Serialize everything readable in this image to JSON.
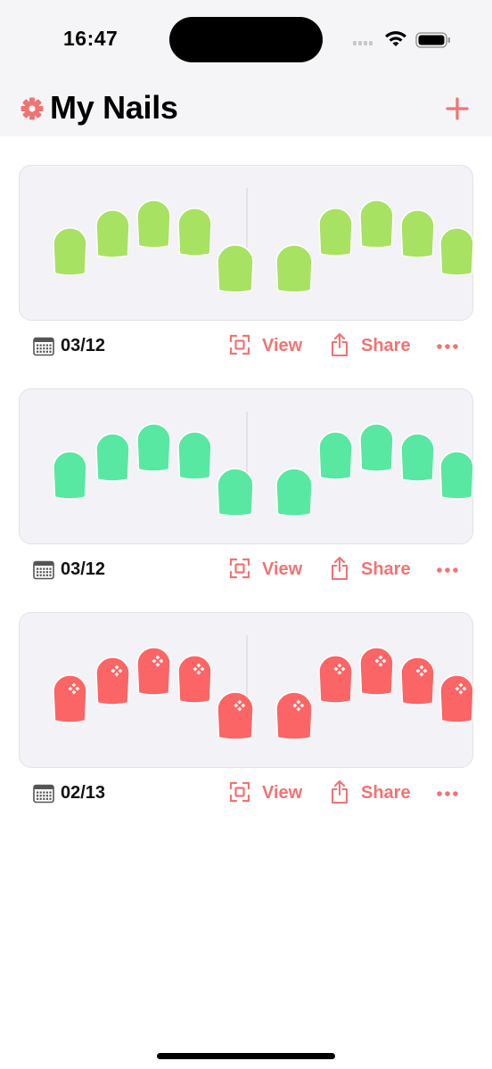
{
  "status_bar": {
    "time": "16:47"
  },
  "header": {
    "title": "My Nails"
  },
  "colors": {
    "accent": "#f07473"
  },
  "actions": {
    "view_label": "View",
    "share_label": "Share"
  },
  "designs": [
    {
      "date": "03/12",
      "nail_color": "#a8e262",
      "decorated": false
    },
    {
      "date": "03/12",
      "nail_color": "#58e8a1",
      "decorated": false
    },
    {
      "date": "02/13",
      "nail_color": "#fc6565",
      "decorated": true
    }
  ]
}
